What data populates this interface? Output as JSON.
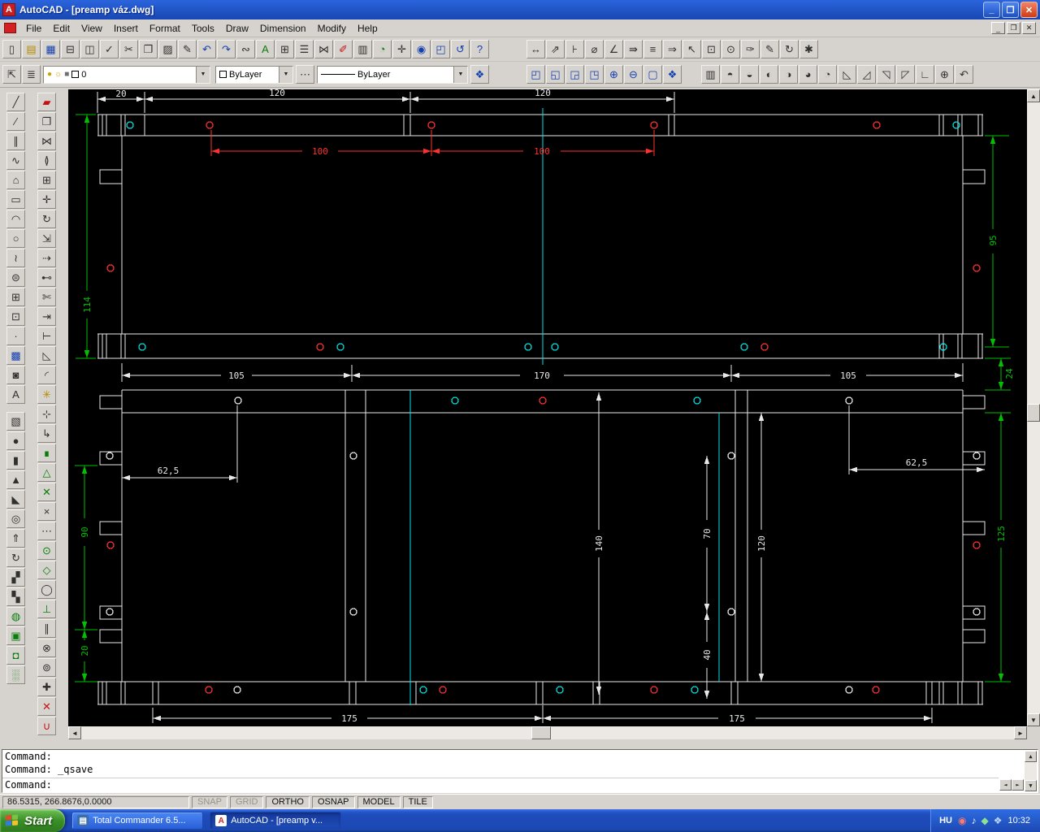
{
  "window": {
    "title": "AutoCAD - [preamp váz.dwg]",
    "controls": {
      "minimize": "_",
      "restore": "❐",
      "close": "✕"
    }
  },
  "icons": {
    "dropdown": "▼",
    "up": "▲",
    "down": "▼",
    "left": "◄",
    "right": "►",
    "bulb": "●",
    "sun": "☼",
    "lock": "■"
  },
  "menu": {
    "items": [
      {
        "id": "menu-file",
        "label": "File"
      },
      {
        "id": "menu-edit",
        "label": "Edit"
      },
      {
        "id": "menu-view",
        "label": "View"
      },
      {
        "id": "menu-insert",
        "label": "Insert"
      },
      {
        "id": "menu-format",
        "label": "Format"
      },
      {
        "id": "menu-tools",
        "label": "Tools"
      },
      {
        "id": "menu-draw",
        "label": "Draw"
      },
      {
        "id": "menu-dimension",
        "label": "Dimension"
      },
      {
        "id": "menu-modify",
        "label": "Modify"
      },
      {
        "id": "menu-help",
        "label": "Help"
      }
    ]
  },
  "toolbars": {
    "standard": [
      {
        "n": "new-icon",
        "g": "▯"
      },
      {
        "n": "open-icon",
        "g": "▤",
        "c": "yellow"
      },
      {
        "n": "save-icon",
        "g": "▦",
        "c": "blue"
      },
      {
        "n": "print-icon",
        "g": "⊟"
      },
      {
        "n": "print-preview-icon",
        "g": "◫"
      },
      {
        "n": "spelling-icon",
        "g": "✓"
      },
      {
        "n": "cut-icon",
        "g": "✂"
      },
      {
        "n": "copy-icon",
        "g": "❐"
      },
      {
        "n": "paste-icon",
        "g": "▨"
      },
      {
        "n": "match-properties-icon",
        "g": "✎"
      },
      {
        "n": "undo-icon",
        "g": "↶",
        "c": "blue"
      },
      {
        "n": "redo-icon",
        "g": "↷",
        "c": "blue"
      },
      {
        "n": "insert-hyperlink-icon",
        "g": "∾"
      },
      {
        "n": "today-icon",
        "g": "A",
        "c": "green"
      },
      {
        "n": "designcenter-icon",
        "g": "⊞"
      },
      {
        "n": "properties-window-icon",
        "g": "☰"
      },
      {
        "n": "dbconnect-icon",
        "g": "⋈"
      },
      {
        "n": "redraw-icon",
        "g": "✐",
        "c": "red"
      },
      {
        "n": "named-views-icon",
        "g": "▥"
      },
      {
        "n": "3d-orbit-icon",
        "g": "◔",
        "c": "green"
      },
      {
        "n": "pan-realtime-icon",
        "g": "✛"
      },
      {
        "n": "zoom-realtime-icon",
        "g": "◉",
        "c": "blue"
      },
      {
        "n": "zoom-window-icon",
        "g": "◰",
        "c": "blue"
      },
      {
        "n": "zoom-previous-icon",
        "g": "↺",
        "c": "blue"
      },
      {
        "n": "help-icon",
        "g": "?",
        "c": "blue"
      }
    ],
    "dimension": [
      {
        "n": "linear-dimension-icon",
        "g": "↔"
      },
      {
        "n": "aligned-dimension-icon",
        "g": "⇗"
      },
      {
        "n": "ordinate-dimension-icon",
        "g": "⊦"
      },
      {
        "n": "radius-dimension-icon",
        "g": "⌀"
      },
      {
        "n": "angular-dimension-icon",
        "g": "∠"
      },
      {
        "n": "quick-dimension-icon",
        "g": "⇛"
      },
      {
        "n": "baseline-dimension-icon",
        "g": "≡"
      },
      {
        "n": "continue-dimension-icon",
        "g": "⇒"
      },
      {
        "n": "quick-leader-icon",
        "g": "↖"
      },
      {
        "n": "tolerance-icon",
        "g": "⊡"
      },
      {
        "n": "center-mark-icon",
        "g": "⊙"
      },
      {
        "n": "dimension-edit-icon",
        "g": "✑"
      },
      {
        "n": "dimension-text-edit-icon",
        "g": "✎"
      },
      {
        "n": "dimension-update-icon",
        "g": "↻"
      },
      {
        "n": "dimension-style-icon",
        "g": "✱"
      }
    ],
    "layer_buttons": [
      {
        "n": "make-object-layer-current-icon",
        "g": "⇱"
      },
      {
        "n": "layers-icon",
        "g": "≣"
      }
    ],
    "layer_value": "0",
    "color_value": "ByLayer",
    "linetype_value": "ByLayer",
    "linetype_button": {
      "n": "linetype-icon",
      "g": "⋯"
    },
    "properties_button": {
      "n": "object-properties-icon",
      "g": "❖",
      "c": "blue"
    },
    "zoom": [
      {
        "n": "zoom-window-icon",
        "g": "◰",
        "c": "blue"
      },
      {
        "n": "zoom-dynamic-icon",
        "g": "◱",
        "c": "blue"
      },
      {
        "n": "zoom-scale-icon",
        "g": "◲",
        "c": "blue"
      },
      {
        "n": "zoom-center-icon",
        "g": "◳",
        "c": "blue"
      },
      {
        "n": "zoom-in-icon",
        "g": "⊕",
        "c": "blue"
      },
      {
        "n": "zoom-out-icon",
        "g": "⊖",
        "c": "blue"
      },
      {
        "n": "zoom-all-icon",
        "g": "▢",
        "c": "blue"
      },
      {
        "n": "zoom-extents-icon",
        "g": "❖",
        "c": "blue"
      }
    ],
    "view": [
      {
        "n": "named-views-icon",
        "g": "▥"
      },
      {
        "n": "top-view-icon",
        "g": "◓"
      },
      {
        "n": "bottom-view-icon",
        "g": "◒"
      },
      {
        "n": "left-view-icon",
        "g": "◐"
      },
      {
        "n": "right-view-icon",
        "g": "◑"
      },
      {
        "n": "front-view-icon",
        "g": "◕"
      },
      {
        "n": "back-view-icon",
        "g": "◔"
      },
      {
        "n": "sw-isometric-view-icon",
        "g": "◺"
      },
      {
        "n": "se-isometric-view-icon",
        "g": "◿"
      },
      {
        "n": "ne-isometric-view-icon",
        "g": "◹"
      },
      {
        "n": "nw-isometric-view-icon",
        "g": "◸"
      },
      {
        "n": "ucs-icon",
        "g": "∟"
      },
      {
        "n": "ucs-world-icon",
        "g": "⊕"
      },
      {
        "n": "ucs-previous-icon",
        "g": "↶"
      }
    ]
  },
  "left_toolbars": {
    "draw": [
      {
        "n": "line-icon",
        "g": "╱"
      },
      {
        "n": "construction-line-icon",
        "g": "∕"
      },
      {
        "n": "multiline-icon",
        "g": "∥"
      },
      {
        "n": "polyline-icon",
        "g": "∿"
      },
      {
        "n": "polygon-icon",
        "g": "⌂"
      },
      {
        "n": "rectangle-icon",
        "g": "▭"
      },
      {
        "n": "arc-icon",
        "g": "◠"
      },
      {
        "n": "circle-icon",
        "g": "○"
      },
      {
        "n": "spline-icon",
        "g": "≀"
      },
      {
        "n": "ellipse-icon",
        "g": "⊜"
      },
      {
        "n": "insert-block-icon",
        "g": "⊞"
      },
      {
        "n": "make-block-icon",
        "g": "⊡"
      },
      {
        "n": "point-icon",
        "g": "·"
      },
      {
        "n": "hatch-icon",
        "g": "▩",
        "c": "blue"
      },
      {
        "n": "region-icon",
        "g": "◙"
      },
      {
        "n": "multiline-text-icon",
        "g": "A"
      }
    ],
    "render": [
      {
        "n": "box-icon",
        "g": "▧"
      },
      {
        "n": "sphere-icon",
        "g": "●"
      },
      {
        "n": "cylinder-icon",
        "g": "▮"
      },
      {
        "n": "cone-icon",
        "g": "▲"
      },
      {
        "n": "wedge-icon",
        "g": "◣"
      },
      {
        "n": "torus-icon",
        "g": "◎"
      },
      {
        "n": "extrude-icon",
        "g": "⇑"
      },
      {
        "n": "revolve-icon",
        "g": "↻"
      },
      {
        "n": "slice-icon",
        "g": "▞"
      },
      {
        "n": "section-icon",
        "g": "▚"
      },
      {
        "n": "render-icon",
        "g": "◍",
        "c": "green"
      },
      {
        "n": "scene-icon",
        "g": "▣",
        "c": "green"
      },
      {
        "n": "materials-icon",
        "g": "◘",
        "c": "green"
      },
      {
        "n": "background-icon",
        "g": "░",
        "c": "green"
      }
    ],
    "modify": [
      {
        "n": "erase-icon",
        "g": "▰",
        "c": "red"
      },
      {
        "n": "copy-object-icon",
        "g": "❐"
      },
      {
        "n": "mirror-icon",
        "g": "⋈"
      },
      {
        "n": "offset-icon",
        "g": "≬"
      },
      {
        "n": "array-icon",
        "g": "⊞"
      },
      {
        "n": "move-icon",
        "g": "✛"
      },
      {
        "n": "rotate-icon",
        "g": "↻"
      },
      {
        "n": "scale-icon",
        "g": "⇲"
      },
      {
        "n": "stretch-icon",
        "g": "⇢"
      },
      {
        "n": "lengthen-icon",
        "g": "⊷"
      },
      {
        "n": "trim-icon",
        "g": "✄"
      },
      {
        "n": "extend-icon",
        "g": "⇥"
      },
      {
        "n": "break-icon",
        "g": "⊢"
      },
      {
        "n": "chamfer-icon",
        "g": "◺"
      },
      {
        "n": "fillet-icon",
        "g": "◜"
      },
      {
        "n": "explode-icon",
        "g": "✳",
        "c": "yellow"
      }
    ],
    "osnap": [
      {
        "n": "temporary-tracking-icon",
        "g": "⊹"
      },
      {
        "n": "snap-from-icon",
        "g": "↳"
      },
      {
        "n": "snap-endpoint-icon",
        "g": "∎",
        "c": "green"
      },
      {
        "n": "snap-midpoint-icon",
        "g": "△",
        "c": "green"
      },
      {
        "n": "snap-intersection-icon",
        "g": "✕",
        "c": "green"
      },
      {
        "n": "snap-apparent-intersection-icon",
        "g": "×"
      },
      {
        "n": "snap-extension-icon",
        "g": "⋯"
      },
      {
        "n": "snap-center-icon",
        "g": "⊙",
        "c": "green"
      },
      {
        "n": "snap-quadrant-icon",
        "g": "◇",
        "c": "green"
      },
      {
        "n": "snap-tangent-icon",
        "g": "◯"
      },
      {
        "n": "snap-perpendicular-icon",
        "g": "⊥",
        "c": "green"
      },
      {
        "n": "snap-parallel-icon",
        "g": "∥"
      },
      {
        "n": "snap-insert-icon",
        "g": "⊗"
      },
      {
        "n": "snap-node-icon",
        "g": "⊚"
      },
      {
        "n": "snap-nearest-icon",
        "g": "✚"
      },
      {
        "n": "snap-none-icon",
        "g": "✕",
        "c": "red"
      },
      {
        "n": "osnap-settings-icon",
        "g": "∪",
        "c": "red"
      }
    ]
  },
  "drawing": {
    "dims": {
      "top_20": "20",
      "top_120_left": "120",
      "top_120_right": "120",
      "red_100_left": "100",
      "red_100_right": "100",
      "mid_105_left": "105",
      "mid_170": "170",
      "mid_105_right": "105",
      "left_114": "114",
      "left_90": "90",
      "left_20": "20",
      "right_95": "95",
      "right_24": "24",
      "right_125": "125",
      "inner_140": "140",
      "inner_70": "70",
      "inner_40": "40",
      "inner_120": "120",
      "left_62_5": "62,5",
      "right_62_5": "62,5",
      "bottom_175_left": "175",
      "bottom_175_right": "175"
    }
  },
  "command": {
    "history": [
      "Command:",
      "Command: _qsave"
    ],
    "prompt": "Command:"
  },
  "statusbar": {
    "coords": "86.5315, 266.8676,0.0000",
    "toggles": [
      {
        "id": "snap-toggle",
        "label": "SNAP",
        "state": "off"
      },
      {
        "id": "grid-toggle",
        "label": "GRID",
        "state": "off"
      },
      {
        "id": "ortho-toggle",
        "label": "ORTHO",
        "state": "on"
      },
      {
        "id": "osnap-toggle",
        "label": "OSNAP",
        "state": "on"
      },
      {
        "id": "model-toggle",
        "label": "MODEL",
        "state": "on"
      },
      {
        "id": "tile-toggle",
        "label": "TILE",
        "state": "on"
      }
    ]
  },
  "taskbar": {
    "start_label": "Start",
    "tasks": [
      {
        "label": "Total Commander 6.5...",
        "icon_glyph": "▤"
      },
      {
        "label": "AutoCAD - [preamp v...",
        "icon_glyph": "A"
      }
    ],
    "tray": {
      "language": "HU",
      "time": "10:32",
      "icons": [
        {
          "n": "antivirus-icon",
          "g": "◉",
          "c": "t-red"
        },
        {
          "n": "volume-icon",
          "g": "♪",
          "c": "t-white"
        },
        {
          "n": "network-icon",
          "g": "◆",
          "c": "t-green"
        },
        {
          "n": "update-icon",
          "g": "❖",
          "c": "t-blue"
        }
      ]
    }
  },
  "colors": {
    "canvas-bg": "#000000",
    "line": "#e8e8e8",
    "dim-green": "#00c000",
    "dim-red": "#ff3030",
    "centerline": "#00e0e0"
  }
}
